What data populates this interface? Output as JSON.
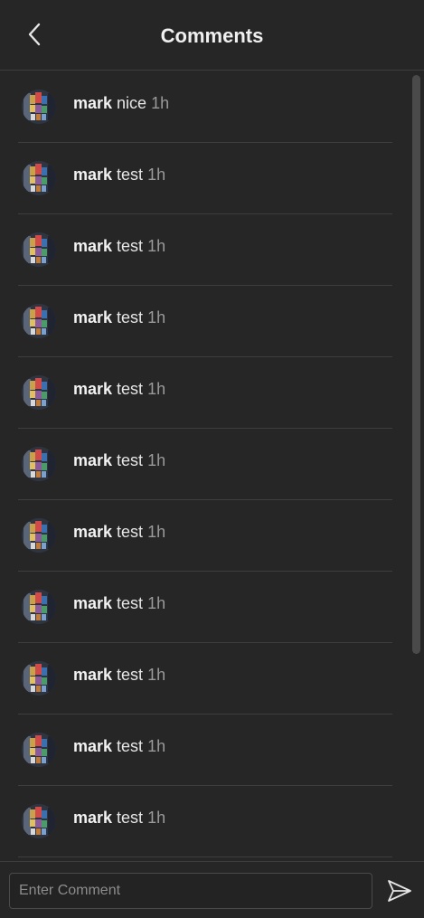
{
  "header": {
    "title": "Comments",
    "back_icon": "chevron-left-icon"
  },
  "comments": [
    {
      "user": "mark",
      "text": "nice",
      "time": "1h"
    },
    {
      "user": "mark",
      "text": "test",
      "time": "1h"
    },
    {
      "user": "mark",
      "text": "test",
      "time": "1h"
    },
    {
      "user": "mark",
      "text": "test",
      "time": "1h"
    },
    {
      "user": "mark",
      "text": "test",
      "time": "1h"
    },
    {
      "user": "mark",
      "text": "test",
      "time": "1h"
    },
    {
      "user": "mark",
      "text": "test",
      "time": "1h"
    },
    {
      "user": "mark",
      "text": "test",
      "time": "1h"
    },
    {
      "user": "mark",
      "text": "test",
      "time": "1h"
    },
    {
      "user": "mark",
      "text": "test",
      "time": "1h"
    },
    {
      "user": "mark",
      "text": "test",
      "time": "1h"
    }
  ],
  "footer": {
    "input_placeholder": "Enter Comment",
    "input_value": "",
    "send_icon": "send-icon"
  },
  "colors": {
    "background": "#262626",
    "divider": "#3e3e3e",
    "text": "#e8e8e8",
    "muted": "#9a9a9a"
  }
}
